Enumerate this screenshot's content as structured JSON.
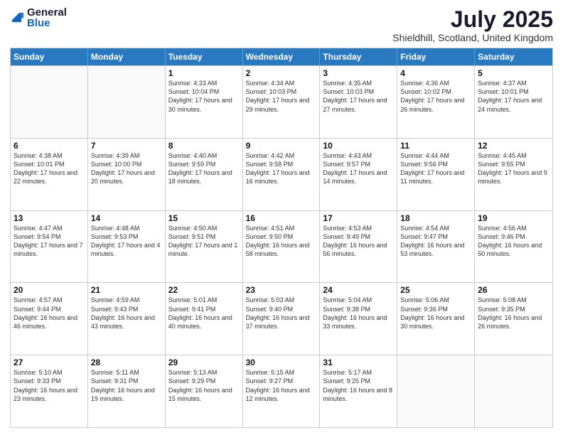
{
  "logo": {
    "general": "General",
    "blue": "Blue"
  },
  "header": {
    "title": "July 2025",
    "location": "Shieldhill, Scotland, United Kingdom"
  },
  "days": [
    "Sunday",
    "Monday",
    "Tuesday",
    "Wednesday",
    "Thursday",
    "Friday",
    "Saturday"
  ],
  "weeks": [
    [
      {
        "day": "",
        "sunrise": "",
        "sunset": "",
        "daylight": ""
      },
      {
        "day": "",
        "sunrise": "",
        "sunset": "",
        "daylight": ""
      },
      {
        "day": "1",
        "sunrise": "Sunrise: 4:33 AM",
        "sunset": "Sunset: 10:04 PM",
        "daylight": "Daylight: 17 hours and 30 minutes."
      },
      {
        "day": "2",
        "sunrise": "Sunrise: 4:34 AM",
        "sunset": "Sunset: 10:03 PM",
        "daylight": "Daylight: 17 hours and 29 minutes."
      },
      {
        "day": "3",
        "sunrise": "Sunrise: 4:35 AM",
        "sunset": "Sunset: 10:03 PM",
        "daylight": "Daylight: 17 hours and 27 minutes."
      },
      {
        "day": "4",
        "sunrise": "Sunrise: 4:36 AM",
        "sunset": "Sunset: 10:02 PM",
        "daylight": "Daylight: 17 hours and 26 minutes."
      },
      {
        "day": "5",
        "sunrise": "Sunrise: 4:37 AM",
        "sunset": "Sunset: 10:01 PM",
        "daylight": "Daylight: 17 hours and 24 minutes."
      }
    ],
    [
      {
        "day": "6",
        "sunrise": "Sunrise: 4:38 AM",
        "sunset": "Sunset: 10:01 PM",
        "daylight": "Daylight: 17 hours and 22 minutes."
      },
      {
        "day": "7",
        "sunrise": "Sunrise: 4:39 AM",
        "sunset": "Sunset: 10:00 PM",
        "daylight": "Daylight: 17 hours and 20 minutes."
      },
      {
        "day": "8",
        "sunrise": "Sunrise: 4:40 AM",
        "sunset": "Sunset: 9:59 PM",
        "daylight": "Daylight: 17 hours and 18 minutes."
      },
      {
        "day": "9",
        "sunrise": "Sunrise: 4:42 AM",
        "sunset": "Sunset: 9:58 PM",
        "daylight": "Daylight: 17 hours and 16 minutes."
      },
      {
        "day": "10",
        "sunrise": "Sunrise: 4:43 AM",
        "sunset": "Sunset: 9:57 PM",
        "daylight": "Daylight: 17 hours and 14 minutes."
      },
      {
        "day": "11",
        "sunrise": "Sunrise: 4:44 AM",
        "sunset": "Sunset: 9:56 PM",
        "daylight": "Daylight: 17 hours and 11 minutes."
      },
      {
        "day": "12",
        "sunrise": "Sunrise: 4:45 AM",
        "sunset": "Sunset: 9:55 PM",
        "daylight": "Daylight: 17 hours and 9 minutes."
      }
    ],
    [
      {
        "day": "13",
        "sunrise": "Sunrise: 4:47 AM",
        "sunset": "Sunset: 9:54 PM",
        "daylight": "Daylight: 17 hours and 7 minutes."
      },
      {
        "day": "14",
        "sunrise": "Sunrise: 4:48 AM",
        "sunset": "Sunset: 9:53 PM",
        "daylight": "Daylight: 17 hours and 4 minutes."
      },
      {
        "day": "15",
        "sunrise": "Sunrise: 4:50 AM",
        "sunset": "Sunset: 9:51 PM",
        "daylight": "Daylight: 17 hours and 1 minute."
      },
      {
        "day": "16",
        "sunrise": "Sunrise: 4:51 AM",
        "sunset": "Sunset: 9:50 PM",
        "daylight": "Daylight: 16 hours and 58 minutes."
      },
      {
        "day": "17",
        "sunrise": "Sunrise: 4:53 AM",
        "sunset": "Sunset: 9:49 PM",
        "daylight": "Daylight: 16 hours and 56 minutes."
      },
      {
        "day": "18",
        "sunrise": "Sunrise: 4:54 AM",
        "sunset": "Sunset: 9:47 PM",
        "daylight": "Daylight: 16 hours and 53 minutes."
      },
      {
        "day": "19",
        "sunrise": "Sunrise: 4:56 AM",
        "sunset": "Sunset: 9:46 PM",
        "daylight": "Daylight: 16 hours and 50 minutes."
      }
    ],
    [
      {
        "day": "20",
        "sunrise": "Sunrise: 4:57 AM",
        "sunset": "Sunset: 9:44 PM",
        "daylight": "Daylight: 16 hours and 46 minutes."
      },
      {
        "day": "21",
        "sunrise": "Sunrise: 4:59 AM",
        "sunset": "Sunset: 9:43 PM",
        "daylight": "Daylight: 16 hours and 43 minutes."
      },
      {
        "day": "22",
        "sunrise": "Sunrise: 5:01 AM",
        "sunset": "Sunset: 9:41 PM",
        "daylight": "Daylight: 16 hours and 40 minutes."
      },
      {
        "day": "23",
        "sunrise": "Sunrise: 5:03 AM",
        "sunset": "Sunset: 9:40 PM",
        "daylight": "Daylight: 16 hours and 37 minutes."
      },
      {
        "day": "24",
        "sunrise": "Sunrise: 5:04 AM",
        "sunset": "Sunset: 9:38 PM",
        "daylight": "Daylight: 16 hours and 33 minutes."
      },
      {
        "day": "25",
        "sunrise": "Sunrise: 5:06 AM",
        "sunset": "Sunset: 9:36 PM",
        "daylight": "Daylight: 16 hours and 30 minutes."
      },
      {
        "day": "26",
        "sunrise": "Sunrise: 5:08 AM",
        "sunset": "Sunset: 9:35 PM",
        "daylight": "Daylight: 16 hours and 26 minutes."
      }
    ],
    [
      {
        "day": "27",
        "sunrise": "Sunrise: 5:10 AM",
        "sunset": "Sunset: 9:33 PM",
        "daylight": "Daylight: 16 hours and 23 minutes."
      },
      {
        "day": "28",
        "sunrise": "Sunrise: 5:11 AM",
        "sunset": "Sunset: 9:31 PM",
        "daylight": "Daylight: 16 hours and 19 minutes."
      },
      {
        "day": "29",
        "sunrise": "Sunrise: 5:13 AM",
        "sunset": "Sunset: 9:29 PM",
        "daylight": "Daylight: 16 hours and 15 minutes."
      },
      {
        "day": "30",
        "sunrise": "Sunrise: 5:15 AM",
        "sunset": "Sunset: 9:27 PM",
        "daylight": "Daylight: 16 hours and 12 minutes."
      },
      {
        "day": "31",
        "sunrise": "Sunrise: 5:17 AM",
        "sunset": "Sunset: 9:25 PM",
        "daylight": "Daylight: 16 hours and 8 minutes."
      },
      {
        "day": "",
        "sunrise": "",
        "sunset": "",
        "daylight": ""
      },
      {
        "day": "",
        "sunrise": "",
        "sunset": "",
        "daylight": ""
      }
    ]
  ]
}
